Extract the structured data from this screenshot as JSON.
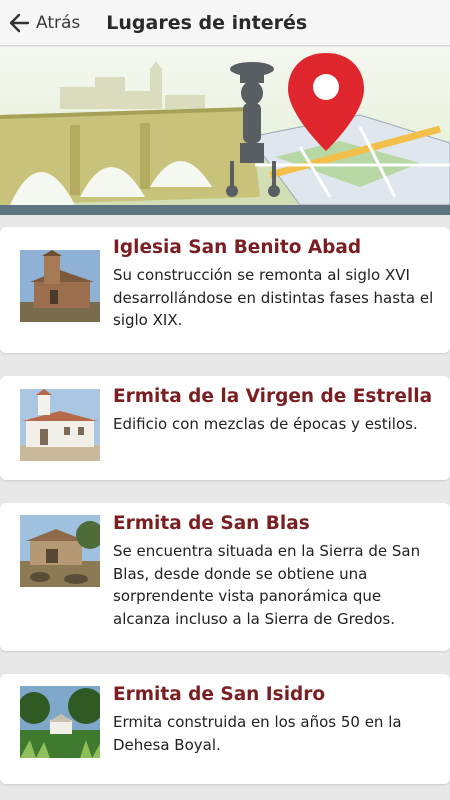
{
  "header": {
    "back_label": "Atrás",
    "title": "Lugares de interés"
  },
  "icons": {
    "back": "arrow-left-icon",
    "banner_pin": "map-pin-icon"
  },
  "colors": {
    "title_accent": "#7a1e22",
    "header_bg": "#f6f6f6",
    "banner_strip": "#5e7380",
    "pin_red": "#e0262d"
  },
  "places": [
    {
      "name": "Iglesia San Benito Abad",
      "description": "Su construcción se remonta al siglo XVI desarrollándose en distintas fases hasta el siglo XIX."
    },
    {
      "name": "Ermita de la Virgen de Estrella",
      "description": "Edificio con mezclas de épocas y estilos."
    },
    {
      "name": "Ermita de San Blas",
      "description": "Se encuentra situada en la Sierra de San Blas, desde donde se obtiene una sorprendente vista panorámica que alcanza incluso a la Sierra de Gredos."
    },
    {
      "name": "Ermita de San Isidro",
      "description": "Ermita construida en los años 50 en la Dehesa Boyal."
    }
  ]
}
